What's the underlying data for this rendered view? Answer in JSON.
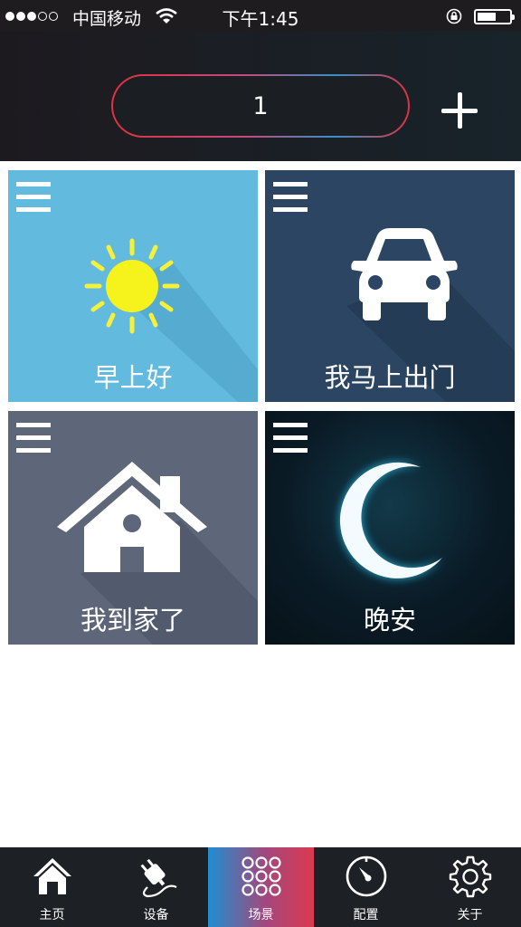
{
  "status_bar": {
    "carrier": "中国移动",
    "time": "下午1:45",
    "signal_bars_filled": 3,
    "signal_bars_total": 5
  },
  "header": {
    "scene_value": "1",
    "add_icon": "plus-icon"
  },
  "tiles": [
    {
      "label": "早上好",
      "icon": "sun-icon",
      "bg": "#62bbdf"
    },
    {
      "label": "我马上出门",
      "icon": "car-icon",
      "bg": "#2c4563"
    },
    {
      "label": "我到家了",
      "icon": "house-icon",
      "bg": "#5d6779"
    },
    {
      "label": "晚安",
      "icon": "moon-icon",
      "bg": "#0a1b26"
    }
  ],
  "tabbar": {
    "active": "场景",
    "items": [
      {
        "label": "主页",
        "icon": "home-icon"
      },
      {
        "label": "设备",
        "icon": "plug-icon"
      },
      {
        "label": "场景",
        "icon": "grid-dots-icon"
      },
      {
        "label": "配置",
        "icon": "timer-dial-icon"
      },
      {
        "label": "关于",
        "icon": "gear-icon"
      }
    ]
  }
}
